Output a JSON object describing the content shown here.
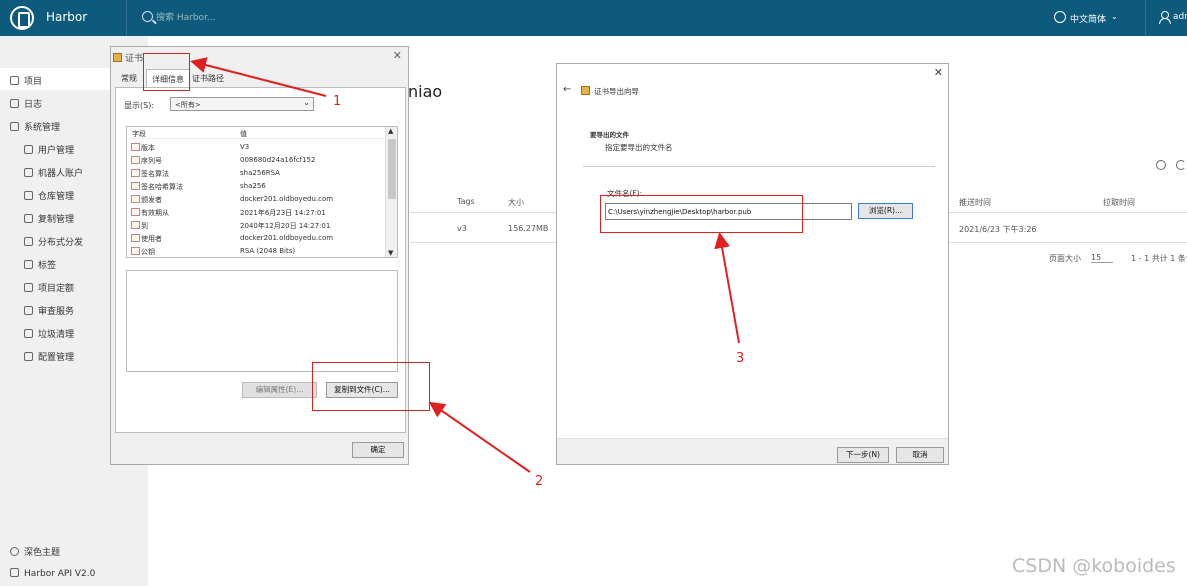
{
  "header": {
    "app_title": "Harbor",
    "search_placeholder": "搜索 Harbor...",
    "language": "中文简体",
    "user": "adr"
  },
  "sidebar": {
    "items": [
      {
        "label": "项目"
      },
      {
        "label": "日志"
      },
      {
        "label": "系统管理"
      },
      {
        "label": "用户管理"
      },
      {
        "label": "机器人账户"
      },
      {
        "label": "仓库管理"
      },
      {
        "label": "复制管理"
      },
      {
        "label": "分布式分发"
      },
      {
        "label": "标签"
      },
      {
        "label": "项目定额"
      },
      {
        "label": "审查服务"
      },
      {
        "label": "垃圾清理"
      },
      {
        "label": "配置管理"
      }
    ],
    "dark_theme": "深色主题",
    "api": "Harbor API V2.0"
  },
  "main": {
    "title_fragment": "niao",
    "table": {
      "headers": [
        "Tags",
        "大小",
        "推送时间",
        "拉取时间"
      ],
      "row": {
        "tags": "v3",
        "size": "156.27MB",
        "push_time": "2021/6/23 下午3:26"
      },
      "footer_page_size_label": "页面大小",
      "footer_page_size": "15",
      "footer_total": "1 - 1 共计 1 条记录"
    }
  },
  "cert_dialog": {
    "title": "证书",
    "tabs": [
      "常规",
      "详细信息",
      "证书路径"
    ],
    "show_label": "显示(S):",
    "show_value": "<所有>",
    "list_header": {
      "field": "字段",
      "value": "值"
    },
    "rows": [
      {
        "field": "版本",
        "value": "V3"
      },
      {
        "field": "序列号",
        "value": "008680d24a16fcf152"
      },
      {
        "field": "签名算法",
        "value": "sha256RSA"
      },
      {
        "field": "签名哈希算法",
        "value": "sha256"
      },
      {
        "field": "颁发者",
        "value": "docker201.oldboyedu.com"
      },
      {
        "field": "有效期从",
        "value": "2021年6月23日 14:27:01"
      },
      {
        "field": "到",
        "value": "2040年12月20日 14:27:01"
      },
      {
        "field": "使用者",
        "value": "docker201.oldboyedu.com"
      },
      {
        "field": "公钥",
        "value": "RSA (2048 Bits)"
      }
    ],
    "edit_button": "编辑属性(E)...",
    "copy_button": "复制到文件(C)...",
    "ok_button": "确定"
  },
  "export_wizard": {
    "title": "证书导出向导",
    "heading": "要导出的文件",
    "subtitle": "指定要导出的文件名",
    "file_label": "文件名(F):",
    "file_value": "C:\\Users\\yinzhengjie\\Desktop\\harbor.pub",
    "browse_button": "浏览(R)...",
    "next_button": "下一步(N)",
    "cancel_button": "取消"
  },
  "annotations": {
    "a1": "1",
    "a2": "2",
    "a3": "3",
    "color": "#e02020"
  },
  "watermark": "CSDN @koboides"
}
